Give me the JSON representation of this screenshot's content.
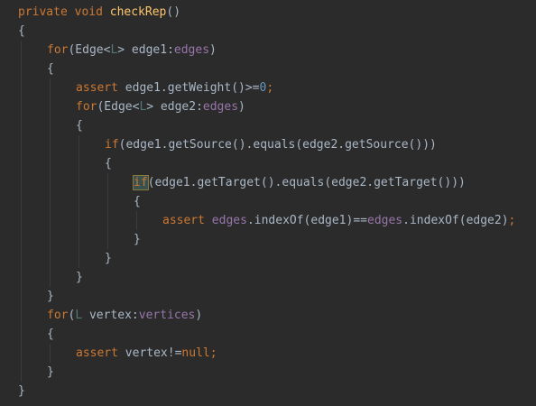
{
  "editor": {
    "lines": [
      {
        "indent": 0,
        "tokens": [
          {
            "t": "private void ",
            "c": "kw"
          },
          {
            "t": "checkRep",
            "c": "fn"
          },
          {
            "t": "()",
            "c": "txt"
          }
        ]
      },
      {
        "indent": 0,
        "tokens": [
          {
            "t": "{",
            "c": "txt"
          }
        ]
      },
      {
        "indent": 1,
        "tokens": [
          {
            "t": "for",
            "c": "kw"
          },
          {
            "t": "(Edge<",
            "c": "txt"
          },
          {
            "t": "L",
            "c": "type"
          },
          {
            "t": "> edge1:",
            "c": "txt"
          },
          {
            "t": "edges",
            "c": "field"
          },
          {
            "t": ")",
            "c": "txt"
          }
        ]
      },
      {
        "indent": 1,
        "tokens": [
          {
            "t": "{",
            "c": "txt"
          }
        ]
      },
      {
        "indent": 2,
        "tokens": [
          {
            "t": "assert ",
            "c": "kw"
          },
          {
            "t": "edge1.getWeight()>=",
            "c": "txt"
          },
          {
            "t": "0",
            "c": "num"
          },
          {
            "t": ";",
            "c": "kw"
          }
        ]
      },
      {
        "indent": 2,
        "tokens": [
          {
            "t": "for",
            "c": "kw"
          },
          {
            "t": "(Edge<",
            "c": "txt"
          },
          {
            "t": "L",
            "c": "type"
          },
          {
            "t": "> edge2:",
            "c": "txt"
          },
          {
            "t": "edges",
            "c": "field"
          },
          {
            "t": ")",
            "c": "txt"
          }
        ]
      },
      {
        "indent": 2,
        "tokens": [
          {
            "t": "{",
            "c": "txt"
          }
        ]
      },
      {
        "indent": 3,
        "tokens": [
          {
            "t": "if",
            "c": "kw"
          },
          {
            "t": "(edge1.getSource().equals(edge2.getSource()))",
            "c": "txt"
          }
        ]
      },
      {
        "indent": 3,
        "tokens": [
          {
            "t": "{",
            "c": "txt"
          }
        ]
      },
      {
        "indent": 4,
        "tokens": [
          {
            "t": "if",
            "c": "match"
          },
          {
            "t": "(edge1.getTarget().equals(edge2.getTarget()))",
            "c": "txt"
          }
        ]
      },
      {
        "indent": 4,
        "tokens": [
          {
            "t": "{",
            "c": "txt"
          }
        ]
      },
      {
        "indent": 5,
        "tokens": [
          {
            "t": "assert ",
            "c": "kw"
          },
          {
            "t": "edges",
            "c": "field"
          },
          {
            "t": ".indexOf(edge1)==",
            "c": "txt"
          },
          {
            "t": "edges",
            "c": "field"
          },
          {
            "t": ".indexOf(edge2)",
            "c": "txt"
          },
          {
            "t": ";",
            "c": "kw"
          }
        ]
      },
      {
        "indent": 4,
        "tokens": [
          {
            "t": "}",
            "c": "txt"
          }
        ]
      },
      {
        "indent": 3,
        "tokens": [
          {
            "t": "}",
            "c": "txt"
          }
        ]
      },
      {
        "indent": 2,
        "tokens": [
          {
            "t": "}",
            "c": "txt"
          }
        ]
      },
      {
        "indent": 1,
        "tokens": [
          {
            "t": "}",
            "c": "txt"
          }
        ]
      },
      {
        "indent": 1,
        "tokens": [
          {
            "t": "for",
            "c": "kw"
          },
          {
            "t": "(",
            "c": "txt"
          },
          {
            "t": "L",
            "c": "type"
          },
          {
            "t": " vertex:",
            "c": "txt"
          },
          {
            "t": "vertices",
            "c": "field"
          },
          {
            "t": ")",
            "c": "txt"
          }
        ]
      },
      {
        "indent": 1,
        "tokens": [
          {
            "t": "{",
            "c": "txt"
          }
        ]
      },
      {
        "indent": 2,
        "tokens": [
          {
            "t": "assert ",
            "c": "kw"
          },
          {
            "t": "vertex!=",
            "c": "txt"
          },
          {
            "t": "null",
            "c": "kw"
          },
          {
            "t": ";",
            "c": "kw"
          }
        ]
      },
      {
        "indent": 1,
        "tokens": [
          {
            "t": "}",
            "c": "txt"
          }
        ]
      },
      {
        "indent": 0,
        "tokens": [
          {
            "t": "}",
            "c": "txt"
          }
        ]
      }
    ]
  },
  "colors": {
    "background": "#2b2b2b",
    "keyword": "#cc7832",
    "method": "#ffc66d",
    "field": "#9876aa",
    "type_param": "#507874",
    "number": "#6897bb",
    "text": "#a9b7c6",
    "indent_guide": "#3b3b3b"
  }
}
